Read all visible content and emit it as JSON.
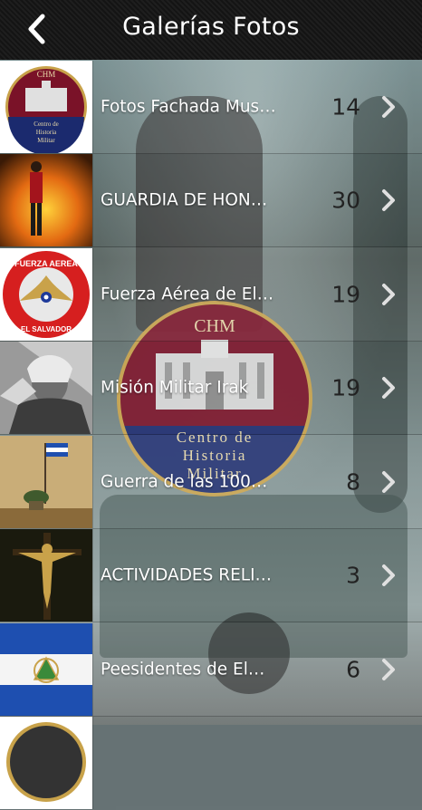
{
  "header": {
    "title": "Galerías Fotos",
    "back_icon": "chevron-left-icon"
  },
  "background": {
    "emblem": {
      "top_text": "CHM",
      "line1": "Centro de",
      "line2": "Historia",
      "line3": "Militar",
      "colors": {
        "top": "#7a1228",
        "bottom": "#1b2a6e",
        "gold": "#c8a24a"
      }
    }
  },
  "galleries": [
    {
      "label": "Fotos Fachada Mus…",
      "count": "14",
      "thumb": "chm-logo"
    },
    {
      "label": "GUARDIA DE HON…",
      "count": "30",
      "thumb": "honor-guard-photo"
    },
    {
      "label": "Fuerza Aérea de El…",
      "count": "19",
      "thumb": "air-force-emblem",
      "thumb_text": {
        "top": "FUERZA AEREA",
        "bottom": "EL SALVADOR"
      }
    },
    {
      "label": "Misión Militar Irak",
      "count": "19",
      "thumb": "iraq-mission-photo"
    },
    {
      "label": "Guerra de las 100…",
      "count": "8",
      "thumb": "war-memorial-photo"
    },
    {
      "label": "ACTIVIDADES RELI…",
      "count": "3",
      "thumb": "crucifix-photo"
    },
    {
      "label": "Peesidentes de El…",
      "count": "6",
      "thumb": "el-salvador-flag"
    },
    {
      "label": "",
      "count": "",
      "thumb": "partial-logo"
    }
  ],
  "colors": {
    "row_text": "#ffffff",
    "count_text": "#222222",
    "chevron": "#e0e0e0"
  }
}
